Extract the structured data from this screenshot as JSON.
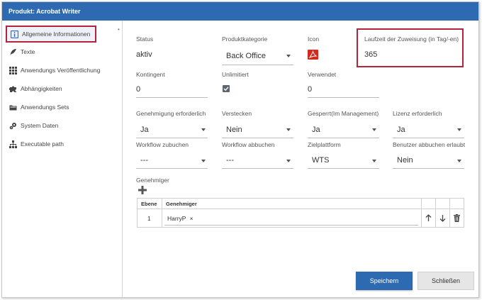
{
  "window": {
    "title": "Produkt: Acrobat Writer"
  },
  "sidebar": {
    "items": [
      {
        "label": "Allgemeine Informationen",
        "icon": "info-box-icon"
      },
      {
        "label": "Texte",
        "icon": "feather-icon"
      },
      {
        "label": "Anwendungs Veröffentlichung",
        "icon": "grid-icon"
      },
      {
        "label": "Abhängigkeiten",
        "icon": "puzzle-icon"
      },
      {
        "label": "Anwendungs Sets",
        "icon": "folder-icon"
      },
      {
        "label": "System Daten",
        "icon": "gear-icon"
      },
      {
        "label": "Executable path",
        "icon": "hierarchy-icon"
      }
    ]
  },
  "form": {
    "status": {
      "label": "Status",
      "value": "aktiv"
    },
    "produktkategorie": {
      "label": "Produktkategorie",
      "value": "Back Office"
    },
    "icon": {
      "label": "Icon"
    },
    "laufzeit": {
      "label": "Laufzeit der Zuweisung (in Tag/-en)",
      "value": "365"
    },
    "kontingent": {
      "label": "Kontingent",
      "value": "0"
    },
    "unlimitiert": {
      "label": "Unlimitiert",
      "checked": true
    },
    "verwendet": {
      "label": "Verwendet",
      "value": "0"
    },
    "genehmigung": {
      "label": "Genehmigung erforderlich",
      "value": "Ja"
    },
    "verstecken": {
      "label": "Verstecken",
      "value": "Nein"
    },
    "gesperrt": {
      "label": "Gesperrt(Im Management)",
      "value": "Ja"
    },
    "lizenz": {
      "label": "Lizenz erforderlich",
      "value": "Ja"
    },
    "workflow_zubuchen": {
      "label": "Workflow zubuchen",
      "value": "---"
    },
    "workflow_abbuchen": {
      "label": "Workflow abbuchen",
      "value": "---"
    },
    "zielplattform": {
      "label": "Zielplattform",
      "value": "WTS"
    },
    "benutzer_abbuchen": {
      "label": "Benutzer abbuchen erlaubt",
      "value": "Nein"
    }
  },
  "approvers": {
    "label": "Genehmiger",
    "columns": [
      "Ebene",
      "Genehmiger"
    ],
    "rows": [
      {
        "ebene": "1",
        "genehmiger": "HarryP",
        "remove": "×"
      }
    ]
  },
  "buttons": {
    "save": "Speichern",
    "close": "Schließen"
  },
  "colors": {
    "accent": "#2e6ab1",
    "highlight": "#b3243b",
    "pdf": "#d42a1e"
  }
}
